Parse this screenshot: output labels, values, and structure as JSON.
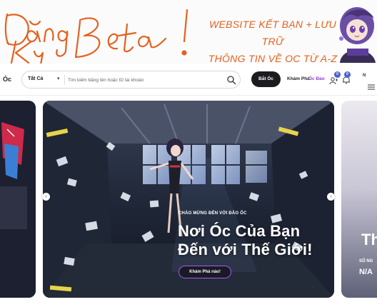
{
  "banner": {
    "script_text": "Đăng Ký Beta !",
    "slogan_line1": "WEBSITE KẾT BẠN + LƯU TRỮ",
    "slogan_line2": "THÔNG TIN VỀ OC TỪ A-Z",
    "accent_color": "#e5611f"
  },
  "header": {
    "logo_fragment": "Óc",
    "search": {
      "category": "Tất Cả",
      "placeholder": "Tìm kiếm bằng tên hoặc ID tài khoản",
      "value": ""
    },
    "primary_button": "Bắt Óc",
    "nav_explore": "Khám Phá",
    "nav_ocdao": "Óc Đảo",
    "badge_users": "0",
    "badge_bell": "0",
    "more_label": "N",
    "active_color": "#8e3bd1"
  },
  "hero": {
    "welcome": "CHÀO MỪNG ĐẾN VỚI ĐẢO ỐC",
    "title_line1": "Nơi Óc Của Bạn",
    "title_line2": "Đến với Thế Giới!",
    "cta": "Khám Phá nào!",
    "cta_border_color": "#a45cf0"
  },
  "next_slide": {
    "big_text": "Th",
    "small1": "SỐ NG",
    "small2": "N/A"
  }
}
